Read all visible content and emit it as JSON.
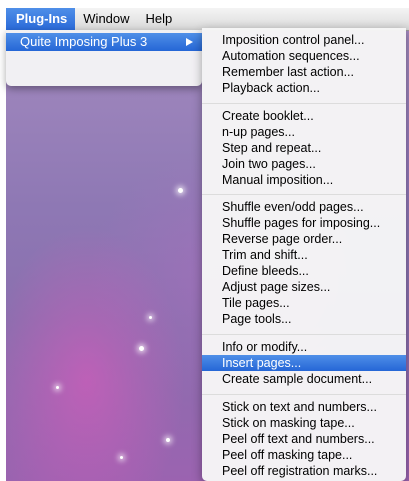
{
  "menubar": {
    "items": [
      {
        "label": "Plug-Ins"
      },
      {
        "label": "Window"
      },
      {
        "label": "Help"
      }
    ]
  },
  "plugins_menu": {
    "items": [
      {
        "label": "Quite Imposing Plus 3"
      }
    ]
  },
  "submenu": {
    "groups": [
      [
        "Imposition control panel...",
        "Automation sequences...",
        "Remember last action...",
        "Playback action..."
      ],
      [
        "Create booklet...",
        "n-up pages...",
        "Step and repeat...",
        "Join two pages...",
        "Manual imposition..."
      ],
      [
        "Shuffle even/odd pages...",
        "Shuffle pages for imposing...",
        "Reverse page order...",
        "Trim and shift...",
        "Define bleeds...",
        "Adjust page sizes...",
        "Tile pages...",
        "Page tools..."
      ],
      [
        "Info or modify...",
        "Insert pages...",
        "Create sample document..."
      ],
      [
        "Stick on text and numbers...",
        "Stick on masking tape...",
        "Peel off text and numbers...",
        "Peel off masking tape...",
        "Peel off registration marks..."
      ]
    ],
    "highlighted": "Insert pages..."
  }
}
